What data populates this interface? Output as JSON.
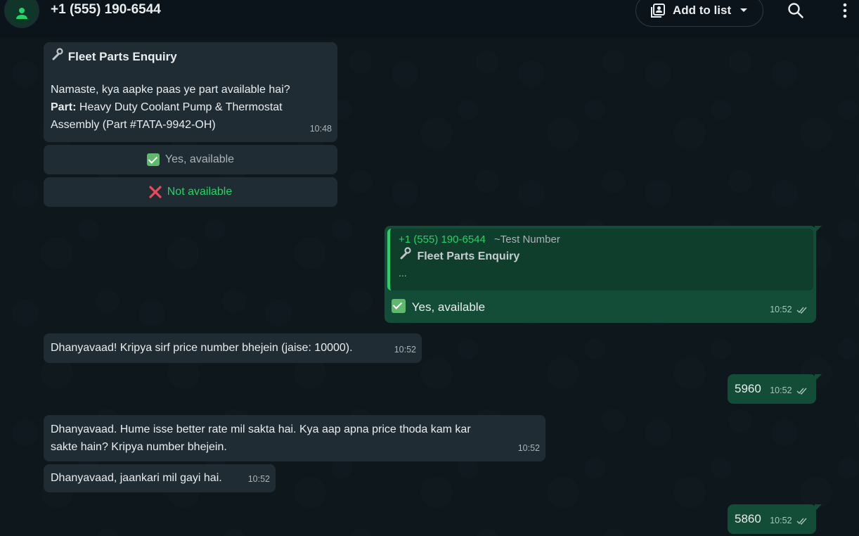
{
  "header": {
    "title": "+1 (555) 190-6544",
    "add_to_list_label": "Add to list"
  },
  "messages": {
    "m1": {
      "title": "Fleet Parts Enquiry",
      "line1": "Namaste, kya aapke paas ye part available hai?",
      "part_label": "Part:",
      "part_value_1": "Heavy Duty Coolant Pump & Thermostat",
      "part_value_2": "Assembly (Part #TATA-9942-OH)",
      "time": "10:48",
      "btn_yes": "Yes, available",
      "btn_no": "Not available"
    },
    "m2": {
      "quote_sender": "+1 (555) 190-6544",
      "quote_name": "~Test Number",
      "quote_title": "Fleet Parts Enquiry",
      "quote_ellipsis": "...",
      "text": "Yes, available",
      "time": "10:52"
    },
    "m3": {
      "text": "Dhanyavaad! Kripya sirf price number bhejein (jaise: 10000).",
      "time": "10:52"
    },
    "m4": {
      "text": "5960",
      "time": "10:52"
    },
    "m5": {
      "line1": "Dhanyavaad. Hume isse better rate mil sakta hai. Kya aap apna price thoda kam kar",
      "line2": "sakte hain? Kripya number bhejein.",
      "time": "10:52"
    },
    "m6": {
      "text": "Dhanyavaad, jaankari mil gayi hai.",
      "time": "10:52"
    },
    "m7": {
      "text": "5860",
      "time": "10:52"
    }
  },
  "colors": {
    "accent": "#25d366",
    "incoming_bubble": "#202c33",
    "outgoing_bubble": "#144d37",
    "no_red": "#ea4a5a",
    "no_text": "#25d366"
  }
}
